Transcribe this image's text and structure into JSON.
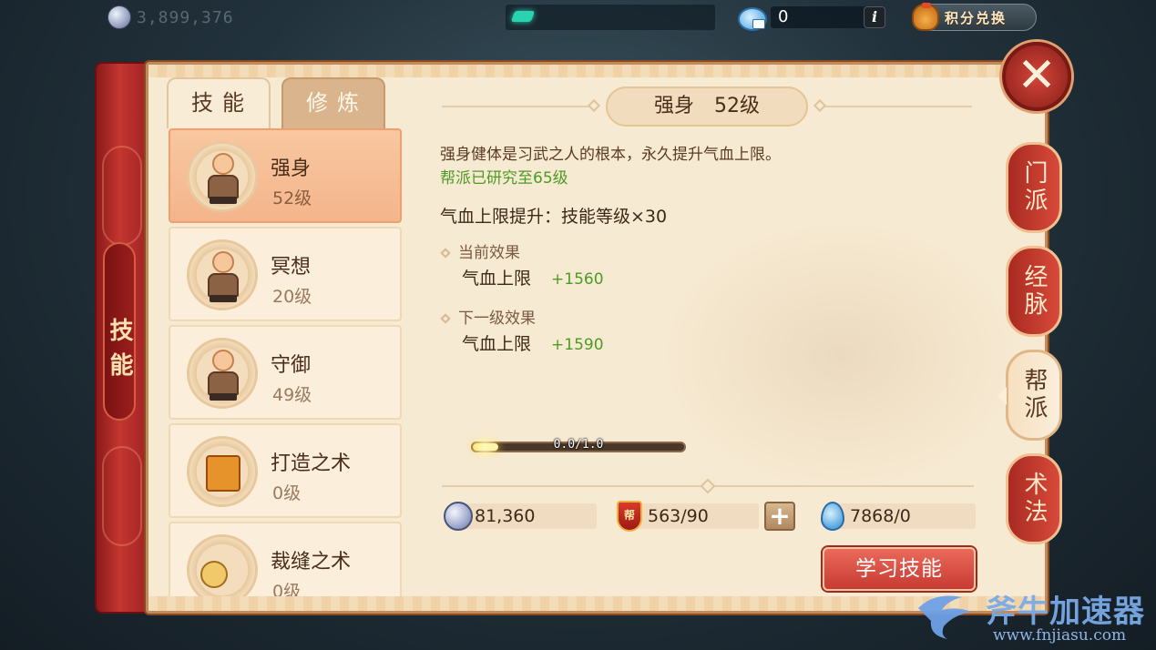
{
  "topbar": {
    "silver_amount": "3,899,376",
    "cloud_currency": "0",
    "info_label": "i",
    "points_exchange_label": "积分兑换"
  },
  "side_title": "技能",
  "tabs": [
    {
      "label": "技能",
      "active": true
    },
    {
      "label": "修炼",
      "active": false
    }
  ],
  "skills": [
    {
      "name": "强身",
      "level": "52级",
      "selected": true
    },
    {
      "name": "冥想",
      "level": "20级",
      "selected": false
    },
    {
      "name": "守御",
      "level": "49级",
      "selected": false
    },
    {
      "name": "打造之术",
      "level": "0级",
      "selected": false
    },
    {
      "name": "裁缝之术",
      "level": "0级",
      "selected": false
    }
  ],
  "detail": {
    "title": "强身　52级",
    "description": "强身健体是习武之人的根本，永久提升气血上限。",
    "research": "帮派已研究至65级",
    "formula": "气血上限提升：技能等级×30",
    "current_effect": {
      "header": "当前效果",
      "stat": "气血上限",
      "value": "+1560"
    },
    "next_effect": {
      "header": "下一级效果",
      "stat": "气血上限",
      "value": "+1590"
    },
    "progress_text": "0.0/1.0",
    "progress_fraction": 0.12
  },
  "resources": {
    "silver": "81,360",
    "gang_icon_label": "帮",
    "gang_contribution": "563/90",
    "plus_label": "+",
    "water": "7868/0"
  },
  "learn_button": "学习技能",
  "close_label": "✕",
  "side_tabs": [
    {
      "label": "门派",
      "active": false
    },
    {
      "label": "经脉",
      "active": false
    },
    {
      "label": "帮派",
      "active": true
    },
    {
      "label": "术法",
      "active": false
    }
  ],
  "watermark": {
    "text": "斧牛加速器",
    "url": "www.fnjiasu.com"
  },
  "colors": {
    "panel_bg": "#f7ead2",
    "accent_red": "#c83a32",
    "positive_green": "#4d9a24"
  }
}
